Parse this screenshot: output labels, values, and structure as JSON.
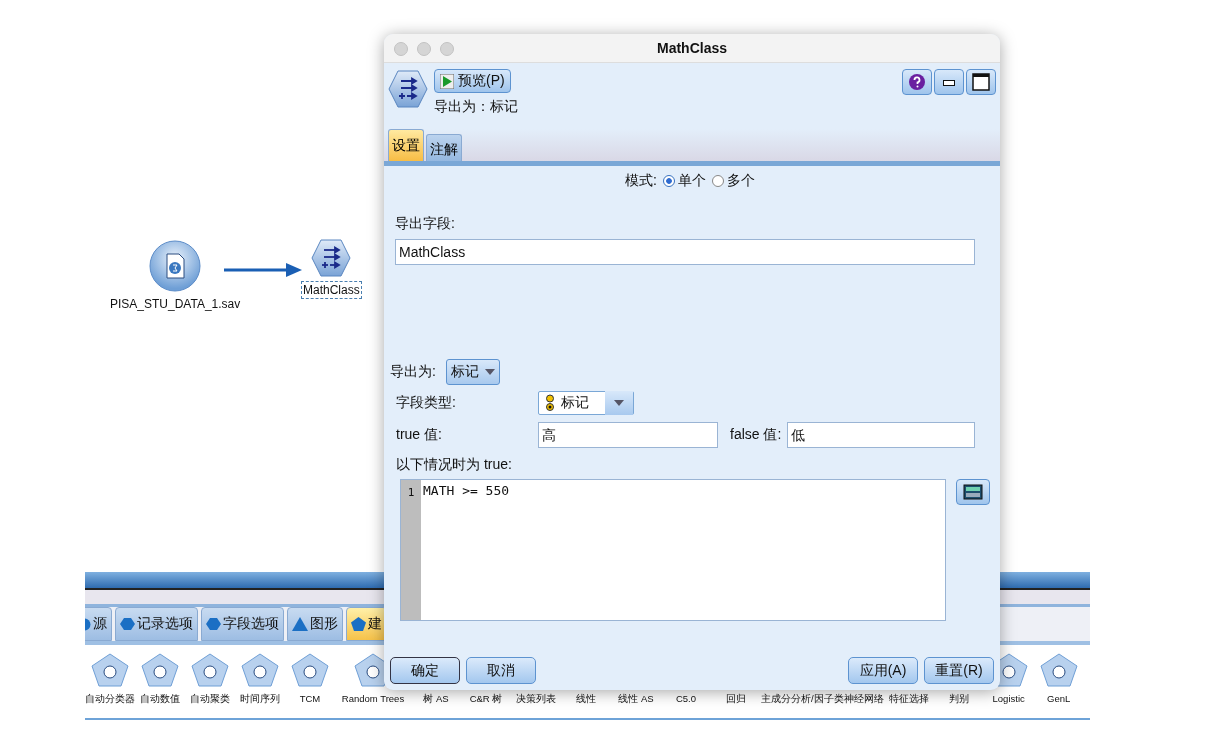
{
  "canvas": {
    "nodes": [
      {
        "kind": "source",
        "label": "PISA_STU_DATA_1.sav",
        "selected": false
      },
      {
        "kind": "derive",
        "label": "MathClass",
        "selected": true
      }
    ]
  },
  "palette": {
    "tabs": [
      {
        "kind": "circle",
        "label": "源",
        "selected": false
      },
      {
        "kind": "hexagon",
        "label": "记录选项",
        "selected": false
      },
      {
        "kind": "hexagon",
        "label": "字段选项",
        "selected": false
      },
      {
        "kind": "triangle",
        "label": "图形",
        "selected": false
      },
      {
        "kind": "pentagon",
        "label": "建",
        "selected": true
      }
    ],
    "items": [
      {
        "label": "自动分类器"
      },
      {
        "label": "自动数值"
      },
      {
        "label": "自动聚类"
      },
      {
        "label": "时间序列"
      },
      {
        "label": "TCM"
      },
      {
        "label": "Random Trees"
      },
      {
        "label": "树 AS"
      },
      {
        "label": "C&R 树"
      },
      {
        "label": "决策列表"
      },
      {
        "label": "线性"
      },
      {
        "label": "线性 AS"
      },
      {
        "label": "C5.0"
      },
      {
        "label": "回归"
      },
      {
        "label": "主成分分析/因子"
      },
      {
        "label": "类神经网络"
      },
      {
        "label": "特征选择"
      },
      {
        "label": "判别"
      },
      {
        "label": "Logistic"
      },
      {
        "label": "GenL"
      }
    ]
  },
  "dialog": {
    "window": {
      "title": "MathClass"
    },
    "preview_button": "预览(P)",
    "derive_as_summary": "导出为：标记",
    "tabs": [
      {
        "label": "设置",
        "selected": true
      },
      {
        "label": "注解",
        "selected": false
      }
    ],
    "mode": {
      "label": "模式:",
      "options": [
        {
          "label": "单个",
          "selected": true
        },
        {
          "label": "多个",
          "selected": false
        }
      ]
    },
    "derive_field": {
      "label": "导出字段:",
      "value": "MathClass"
    },
    "derive_as": {
      "label": "导出为:",
      "value": "标记"
    },
    "field_type": {
      "label": "字段类型:",
      "value": "标记"
    },
    "true_value": {
      "label": "true 值:",
      "value": "高"
    },
    "false_value": {
      "label": "false 值:",
      "value": "低"
    },
    "condition": {
      "label": "以下情况时为 true:",
      "lines": [
        {
          "number": "1",
          "text": "MATH >= 550"
        }
      ]
    },
    "buttons": {
      "left": [
        "确定",
        "取消"
      ],
      "right": [
        "应用(A)",
        "重置(R)"
      ]
    }
  }
}
